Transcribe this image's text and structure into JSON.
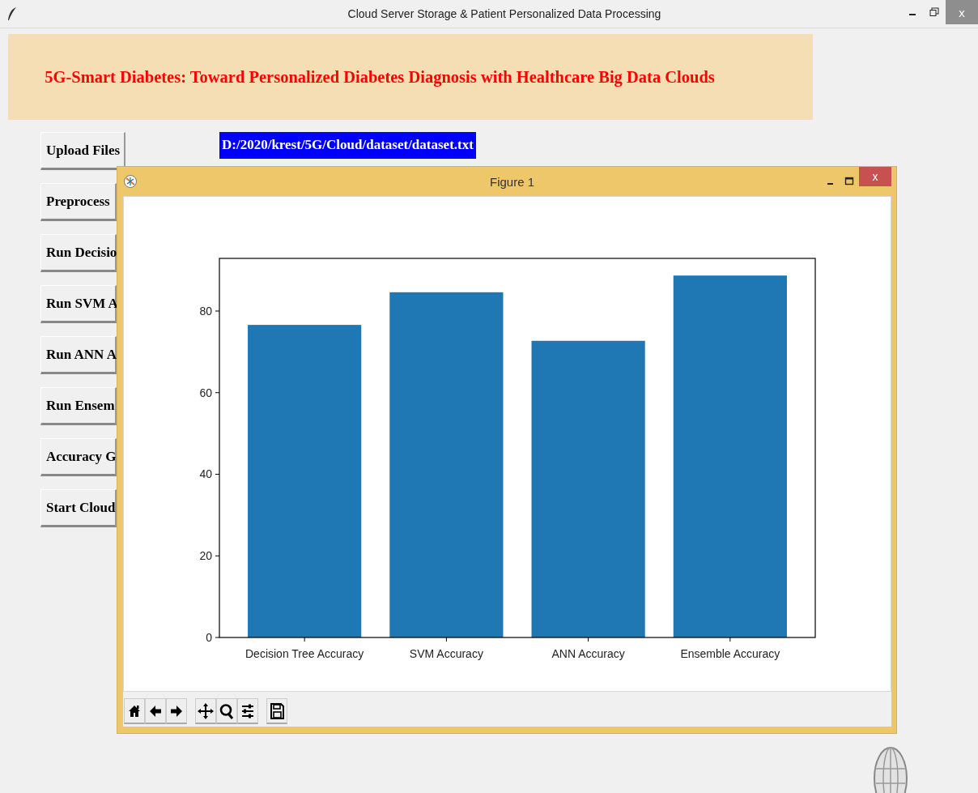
{
  "window": {
    "title": "Cloud Server Storage & Patient Personalized Data Processing",
    "close_label": "x"
  },
  "header": {
    "title": "5G-Smart Diabetes: Toward Personalized Diabetes Diagnosis with Healthcare Big Data Clouds"
  },
  "file_path": "D:/2020/krest/5G/Cloud/dataset/dataset.txt",
  "buttons": [
    "Upload Files",
    "Preprocess",
    "Run Decisio",
    "Run SVM A",
    "Run ANN A",
    "Run Ensem",
    "Accuracy G",
    "Start Cloud"
  ],
  "figure": {
    "title": "Figure 1",
    "close_label": "x",
    "chart_data": {
      "type": "bar",
      "categories": [
        "Decision Tree Accuracy",
        "SVM Accuracy",
        "ANN Accuracy",
        "Ensemble Accuracy"
      ],
      "values": [
        76.6,
        84.6,
        72.7,
        88.7
      ],
      "ylim": [
        0,
        92.9
      ],
      "yticks": [
        0,
        20,
        40,
        60,
        80
      ],
      "color": "#1f77b4"
    }
  }
}
